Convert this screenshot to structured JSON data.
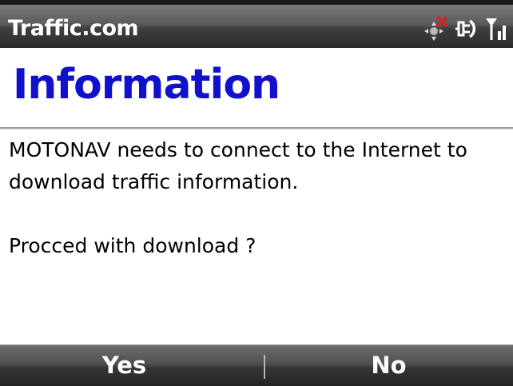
{
  "titlebar": {
    "app_title": "Traffic.com",
    "icons": [
      "gps-error-icon",
      "connection-icon",
      "signal-icon"
    ]
  },
  "dialog": {
    "heading": "Information",
    "message_line1": "MOTONAV needs to connect to the Internet to",
    "message_line2": "download traffic information.",
    "prompt": "Procced with download ?"
  },
  "softkeys": {
    "left_label": "Yes",
    "right_label": "No"
  },
  "colors": {
    "heading": "#1111cc",
    "bar_dark": "#2c2c2c",
    "gps_error": "#e02020"
  }
}
